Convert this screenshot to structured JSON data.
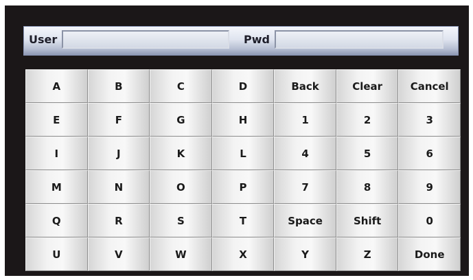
{
  "login": {
    "user_label": "User",
    "user_value": "",
    "pwd_label": "Pwd",
    "pwd_value": ""
  },
  "keys": [
    "A",
    "B",
    "C",
    "D",
    "Back",
    "Clear",
    "Cancel",
    "E",
    "F",
    "G",
    "H",
    "1",
    "2",
    "3",
    "I",
    "J",
    "K",
    "L",
    "4",
    "5",
    "6",
    "M",
    "N",
    "O",
    "P",
    "7",
    "8",
    "9",
    "Q",
    "R",
    "S",
    "T",
    "Space",
    "Shift",
    "0",
    "U",
    "V",
    "W",
    "X",
    "Y",
    "Z",
    "Done"
  ],
  "colors": {
    "frame_background": "#1b1718",
    "bar_gradient_bottom": "#8e98b3",
    "key_face": "#f3f3f3"
  }
}
